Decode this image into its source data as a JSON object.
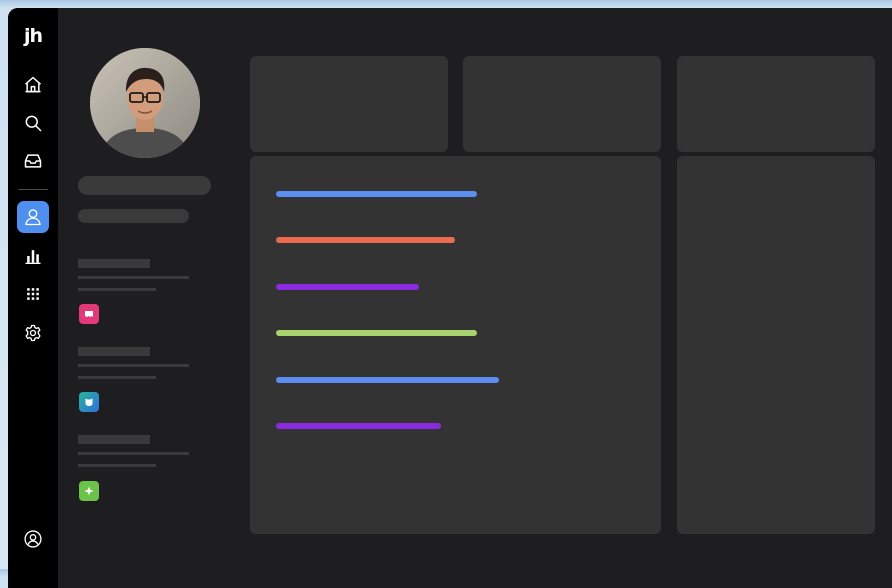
{
  "app": {
    "logo_text": "jh"
  },
  "rail": {
    "items": [
      {
        "icon": "home-icon",
        "active": false
      },
      {
        "icon": "search-icon",
        "active": false
      },
      {
        "icon": "inbox-icon",
        "active": false
      },
      {
        "icon": "user-icon",
        "active": true
      },
      {
        "icon": "bar-chart-icon",
        "active": false
      },
      {
        "icon": "apps-grid-icon",
        "active": false
      },
      {
        "icon": "gear-icon",
        "active": false
      }
    ],
    "bottom_item": {
      "icon": "account-circle-icon"
    },
    "active_color": "#4f8ff0"
  },
  "profile": {
    "avatar": "profile-photo",
    "sections": [
      {
        "icon": "app-icon-pink",
        "color": "#e03a7a"
      },
      {
        "icon": "app-icon-teal-blue",
        "color": "#2f8fe0"
      },
      {
        "icon": "app-icon-green",
        "color": "#6cc24a"
      }
    ]
  },
  "main": {
    "progress_bars": [
      {
        "color": "#5b8ef0",
        "level": 0.55
      },
      {
        "color": "#ec6a4e",
        "level": 0.49
      },
      {
        "color": "#8a2be2",
        "level": 0.39
      },
      {
        "color": "#a8d36c",
        "level": 0.55
      },
      {
        "color": "#5b8ef0",
        "level": 0.61
      },
      {
        "color": "#8a2be2",
        "level": 0.45
      }
    ]
  }
}
